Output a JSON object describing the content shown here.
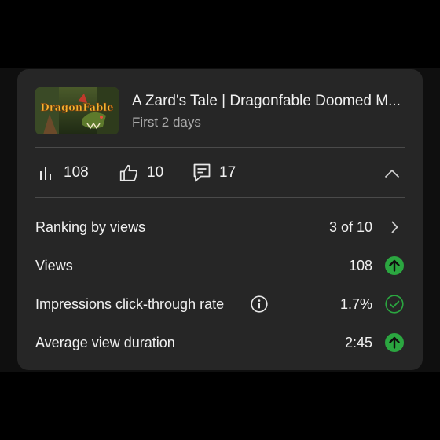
{
  "video": {
    "thumbnail_icon": "dragonfable-thumbnail",
    "thumbnail_logo_text": "DragonFable",
    "title": "A Zard's Tale | Dragonfable Doomed M...",
    "period": "First 2 days"
  },
  "stats": {
    "views": "108",
    "likes": "10",
    "comments": "17"
  },
  "metrics": {
    "ranking_label": "Ranking by views",
    "ranking_value": "3 of 10",
    "views_label": "Views",
    "views_value": "108",
    "ctr_label": "Impressions click-through rate",
    "ctr_value": "1.7%",
    "avd_label": "Average view duration",
    "avd_value": "2:45"
  },
  "colors": {
    "card_bg": "#262626",
    "up_green": "#2ba640",
    "text_primary": "#f1f1f1",
    "text_secondary": "#aaaaaa"
  },
  "icons": [
    "bar-chart-icon",
    "thumbs-up-icon",
    "comment-icon",
    "chevron-up-icon",
    "chevron-right-icon",
    "arrow-up-icon",
    "info-icon",
    "check-circle-icon"
  ]
}
